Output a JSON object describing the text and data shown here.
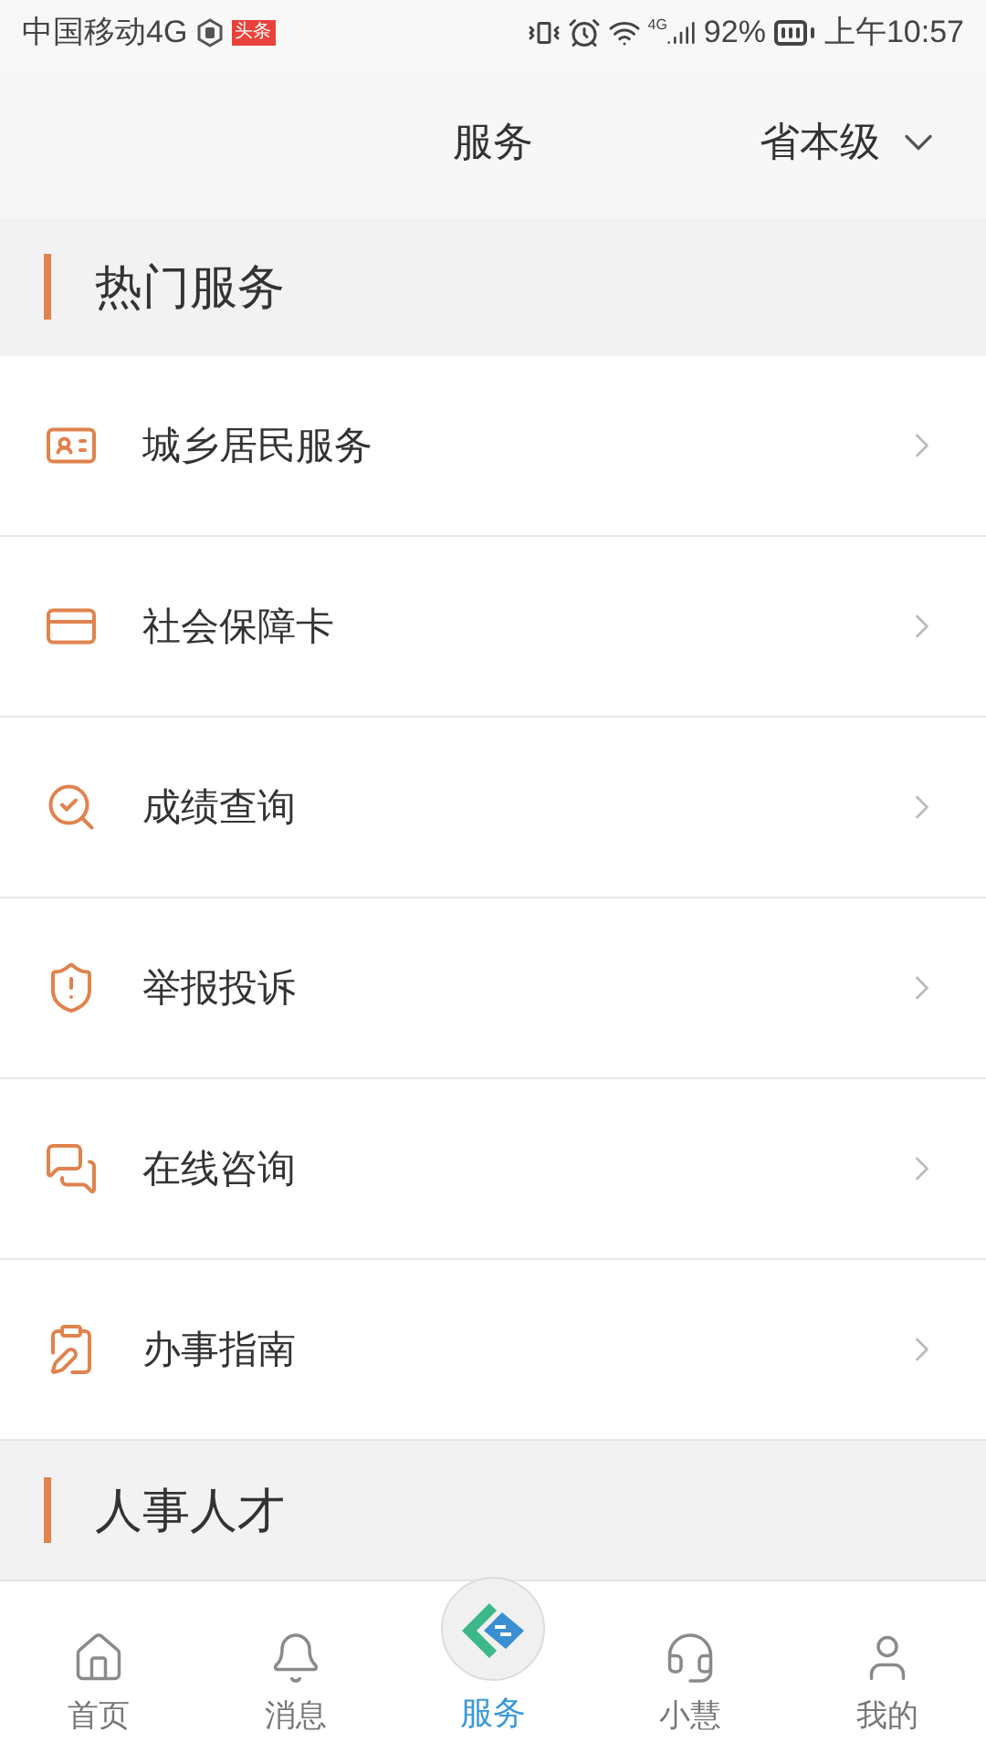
{
  "status_bar": {
    "carrier": "中国移动4G",
    "app_badge": "头条",
    "network": "4G",
    "battery": "92%",
    "time": "上午10:57"
  },
  "header": {
    "title": "服务",
    "region": "省本级"
  },
  "sections": [
    {
      "title": "热门服务",
      "items": [
        {
          "label": "城乡居民服务",
          "kind": "resident"
        },
        {
          "label": "社会保障卡",
          "kind": "card"
        },
        {
          "label": "成绩查询",
          "kind": "search"
        },
        {
          "label": "举报投诉",
          "kind": "shield"
        },
        {
          "label": "在线咨询",
          "kind": "chat"
        },
        {
          "label": "办事指南",
          "kind": "guide"
        }
      ]
    },
    {
      "title": "人事人才"
    }
  ],
  "tabs": [
    {
      "label": "首页",
      "kind": "home",
      "selected": false
    },
    {
      "label": "消息",
      "kind": "bell",
      "selected": false
    },
    {
      "label": "服务",
      "kind": "logo",
      "selected": true
    },
    {
      "label": "小慧",
      "kind": "headset",
      "selected": false
    },
    {
      "label": "我的",
      "kind": "person",
      "selected": false
    }
  ]
}
